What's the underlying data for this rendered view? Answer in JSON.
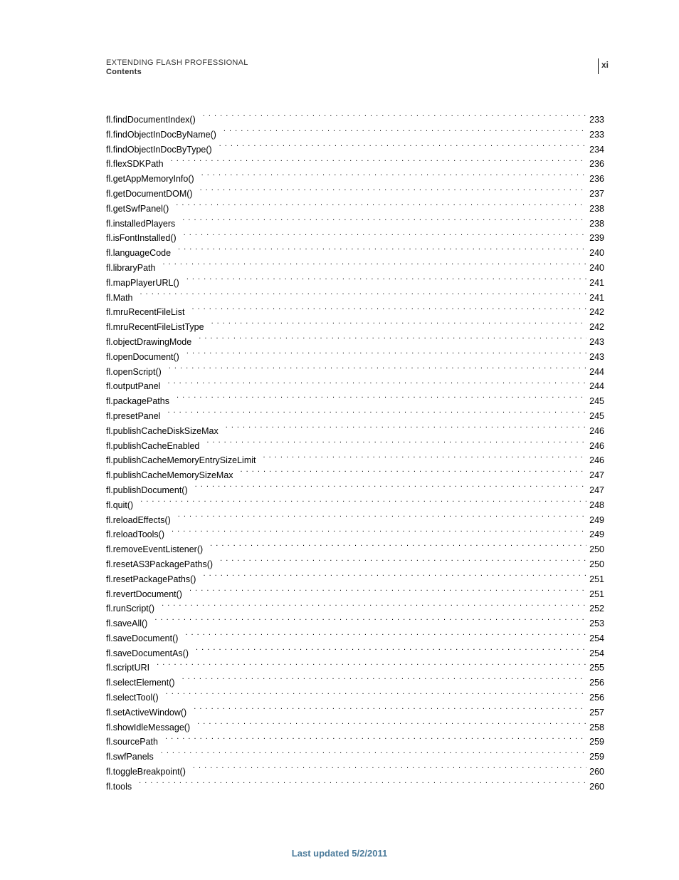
{
  "page_marker": "xi",
  "header": {
    "title": "EXTENDING FLASH PROFESSIONAL",
    "section": "Contents"
  },
  "toc": [
    {
      "label": "fl.findDocumentIndex()",
      "page": "233"
    },
    {
      "label": "fl.findObjectInDocByName()",
      "page": "233"
    },
    {
      "label": "fl.findObjectInDocByType()",
      "page": "234"
    },
    {
      "label": "fl.flexSDKPath",
      "page": "236"
    },
    {
      "label": "fl.getAppMemoryInfo()",
      "page": "236"
    },
    {
      "label": "fl.getDocumentDOM()",
      "page": "237"
    },
    {
      "label": "fl.getSwfPanel()",
      "page": "238"
    },
    {
      "label": "fl.installedPlayers",
      "page": "238"
    },
    {
      "label": "fl.isFontInstalled()",
      "page": "239"
    },
    {
      "label": "fl.languageCode",
      "page": "240"
    },
    {
      "label": "fl.libraryPath",
      "page": "240"
    },
    {
      "label": "fl.mapPlayerURL()",
      "page": "241"
    },
    {
      "label": "fl.Math",
      "page": "241"
    },
    {
      "label": "fl.mruRecentFileList",
      "page": "242"
    },
    {
      "label": "fl.mruRecentFileListType",
      "page": "242"
    },
    {
      "label": "fl.objectDrawingMode",
      "page": "243"
    },
    {
      "label": "fl.openDocument()",
      "page": "243"
    },
    {
      "label": "fl.openScript()",
      "page": "244"
    },
    {
      "label": "fl.outputPanel",
      "page": "244"
    },
    {
      "label": "fl.packagePaths",
      "page": "245"
    },
    {
      "label": "fl.presetPanel",
      "page": "245"
    },
    {
      "label": "fl.publishCacheDiskSizeMax",
      "page": "246"
    },
    {
      "label": "fl.publishCacheEnabled",
      "page": "246"
    },
    {
      "label": "fl.publishCacheMemoryEntrySizeLimit",
      "page": "246"
    },
    {
      "label": "fl.publishCacheMemorySizeMax",
      "page": "247"
    },
    {
      "label": "fl.publishDocument()",
      "page": "247"
    },
    {
      "label": "fl.quit()",
      "page": "248"
    },
    {
      "label": "fl.reloadEffects()",
      "page": "249"
    },
    {
      "label": "fl.reloadTools()",
      "page": "249"
    },
    {
      "label": "fl.removeEventListener()",
      "page": "250"
    },
    {
      "label": "fl.resetAS3PackagePaths()",
      "page": "250"
    },
    {
      "label": "fl.resetPackagePaths()",
      "page": "251"
    },
    {
      "label": "fl.revertDocument()",
      "page": "251"
    },
    {
      "label": "fl.runScript()",
      "page": "252"
    },
    {
      "label": "fl.saveAll()",
      "page": "253"
    },
    {
      "label": "fl.saveDocument()",
      "page": "254"
    },
    {
      "label": "fl.saveDocumentAs()",
      "page": "254"
    },
    {
      "label": "fl.scriptURI",
      "page": "255"
    },
    {
      "label": "fl.selectElement()",
      "page": "256"
    },
    {
      "label": "fl.selectTool()",
      "page": "256"
    },
    {
      "label": "fl.setActiveWindow()",
      "page": "257"
    },
    {
      "label": "fl.showIdleMessage()",
      "page": "258"
    },
    {
      "label": "fl.sourcePath",
      "page": "259"
    },
    {
      "label": "fl.swfPanels",
      "page": "259"
    },
    {
      "label": "fl.toggleBreakpoint()",
      "page": "260"
    },
    {
      "label": "fl.tools",
      "page": "260"
    }
  ],
  "footer": "Last updated 5/2/2011"
}
